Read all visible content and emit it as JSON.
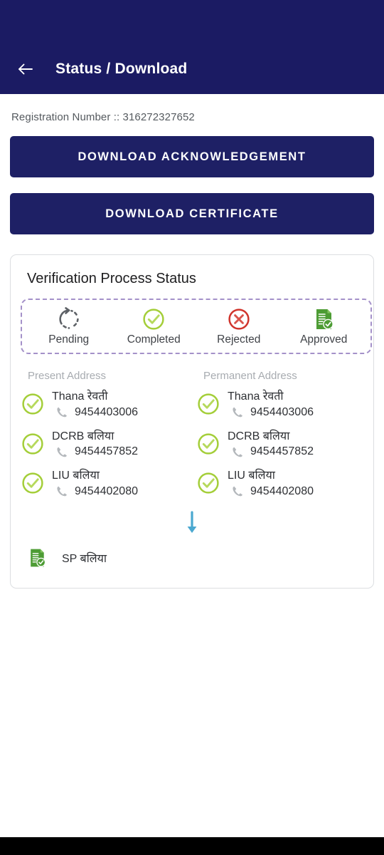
{
  "theme": {
    "navy": "#1b1b63",
    "button_navy": "#1e2065",
    "green": "#a4ce39",
    "red": "#d0342c",
    "gray": "#6e7276",
    "dashed_purple": "#a491c9",
    "arrow_blue": "#4aa8d0",
    "doc_green": "#4d9c34"
  },
  "appbar": {
    "back_icon": "arrow-left-icon",
    "title": "Status / Download"
  },
  "registration": {
    "text": "Registration Number :: 316272327652"
  },
  "actions": {
    "download_acknowledgement": "DOWNLOAD ACKNOWLEDGEMENT",
    "download_certificate": "DOWNLOAD CERTIFICATE"
  },
  "card": {
    "title": "Verification Process Status",
    "legend": [
      {
        "label": "Pending",
        "icon": "pending-refresh-icon"
      },
      {
        "label": "Completed",
        "icon": "check-circle-icon"
      },
      {
        "label": "Rejected",
        "icon": "x-circle-icon"
      },
      {
        "label": "Approved",
        "icon": "document-check-icon"
      }
    ],
    "present_address": {
      "heading": "Present Address",
      "rows": [
        {
          "name": "Thana रेवती",
          "phone": "9454403006",
          "status": "completed"
        },
        {
          "name": "DCRB बलिया",
          "phone": "9454457852",
          "status": "completed"
        },
        {
          "name": "LIU बलिया",
          "phone": "9454402080",
          "status": "completed"
        }
      ]
    },
    "permanent_address": {
      "heading": "Permanent Address",
      "rows": [
        {
          "name": "Thana रेवती",
          "phone": "9454403006",
          "status": "completed"
        },
        {
          "name": "DCRB बलिया",
          "phone": "9454457852",
          "status": "completed"
        },
        {
          "name": "LIU बलिया",
          "phone": "9454402080",
          "status": "completed"
        }
      ]
    },
    "flow_arrow_icon": "arrow-down-icon",
    "final": {
      "label": "SP बलिया",
      "icon": "document-check-icon"
    }
  }
}
